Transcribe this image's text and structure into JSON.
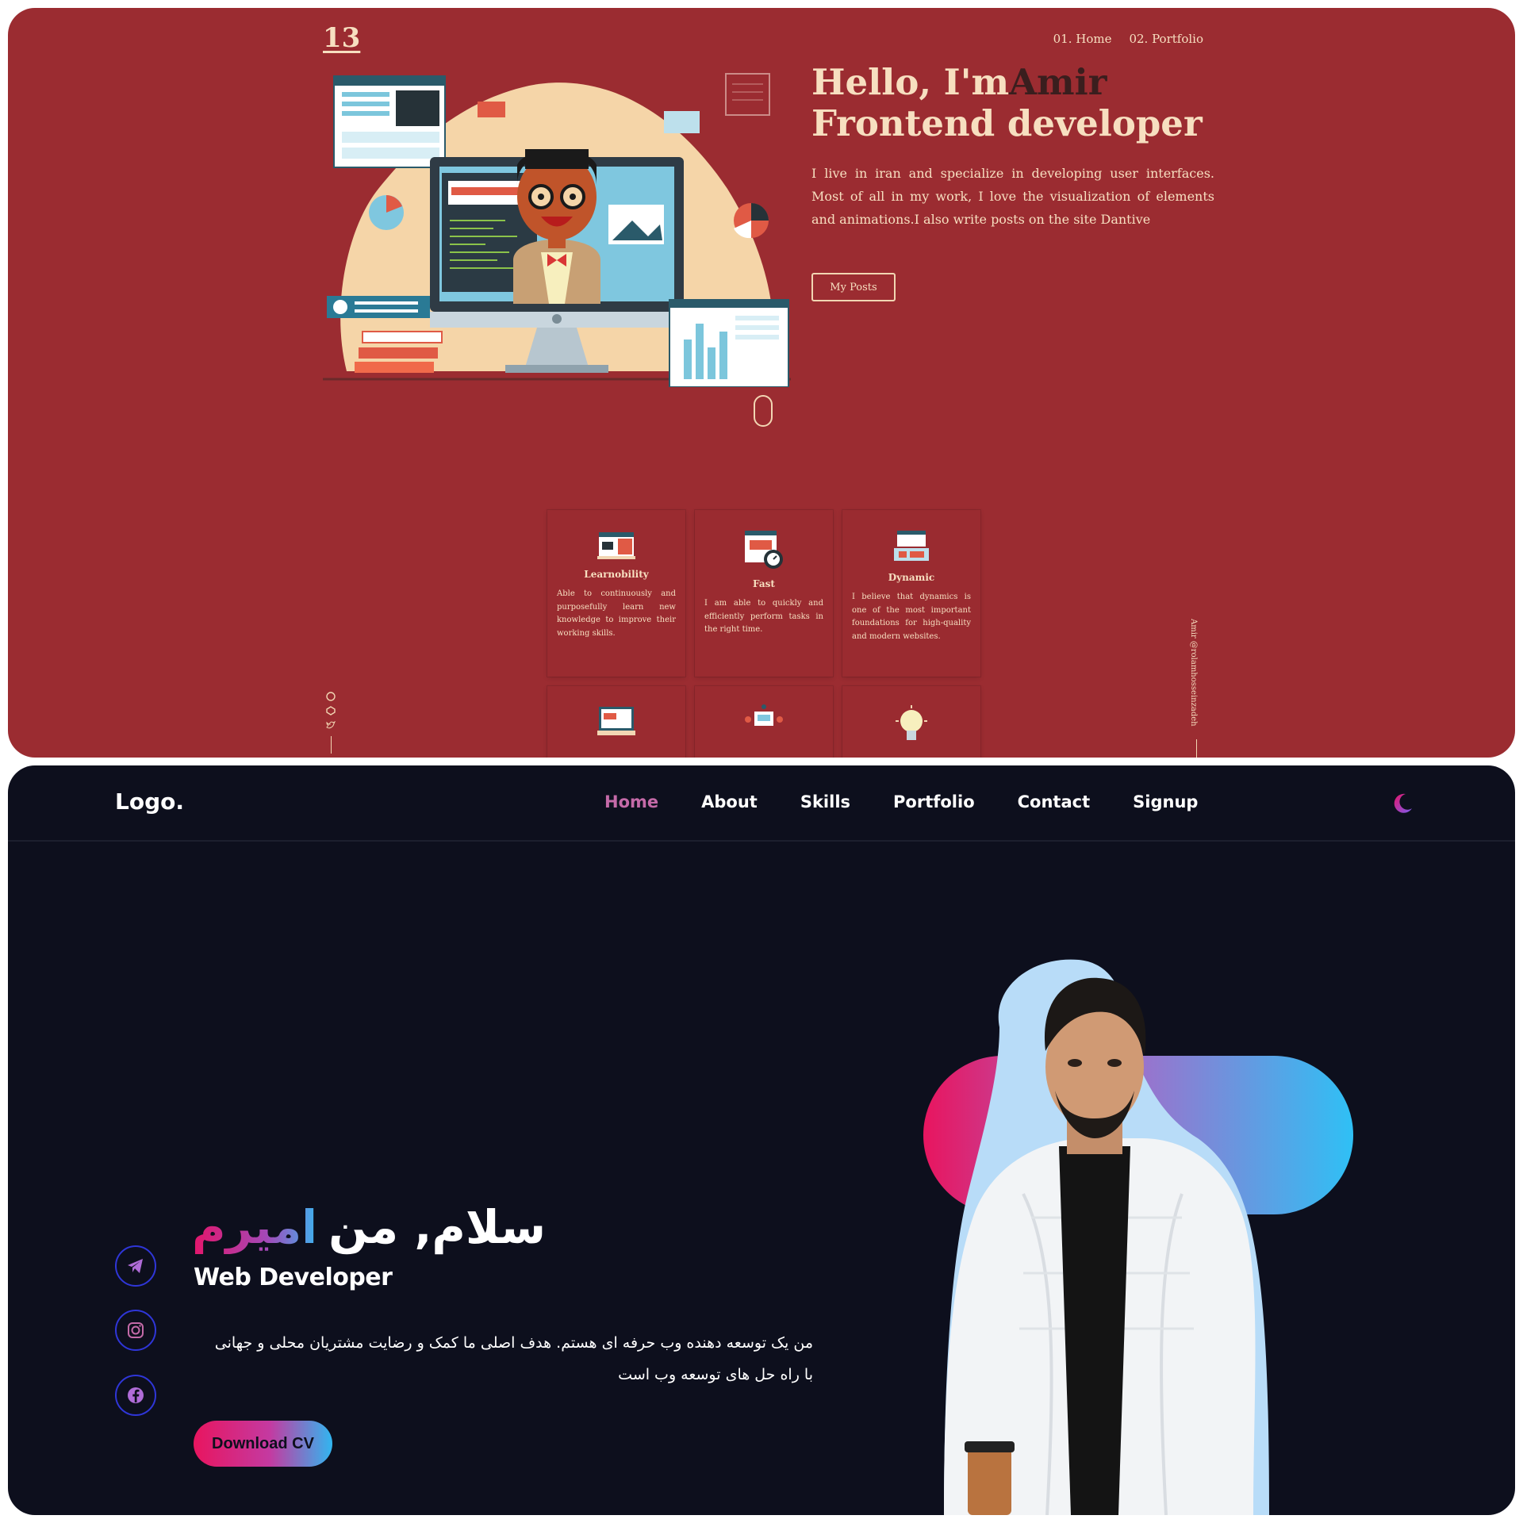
{
  "portfolio_red": {
    "logo": "13",
    "nav": [
      "01. Home",
      "02. Portfolio"
    ],
    "greeting": "Hello, I'm",
    "name": "Amir",
    "role": "Frontend developer",
    "bio": "I live in iran and specialize in developing user interfaces. Most of all in my work, I love the visualization of elements and animations.I also write posts on the site Dantive",
    "button": "My Posts",
    "vertical_text": "Amir @rolamhosseinzadeh",
    "social_icons": [
      "github-icon",
      "codepen-icon",
      "twitter-icon"
    ],
    "cards": [
      {
        "title": "Learnobility",
        "text": "Able to continuously and purposefully learn new knowledge to improve their working skills.",
        "icon": "learning-icon"
      },
      {
        "title": "Fast",
        "text": "I am able to quickly and efficiently perform tasks in the right time.",
        "icon": "stopwatch-icon"
      },
      {
        "title": "Dynamic",
        "text": "I believe that dynamics is one of the most important foundations for high-quality and modern websites.",
        "icon": "dynamic-icon"
      }
    ],
    "colors": {
      "background": "#9b2c31",
      "text": "#f7dfc0",
      "accent": "#3a1e1e"
    }
  },
  "portfolio_dark": {
    "logo": "Logo.",
    "nav": [
      "Home",
      "About",
      "Skills",
      "Portfolio",
      "Contact",
      "Signup"
    ],
    "active_nav": "Home",
    "headline_white": "سلام, من",
    "headline_gradient": "امیرم",
    "role": "Web Developer",
    "description": "من یک توسعه دهنده وب حرفه ای هستم. هدف اصلی ما کمک و رضایت مشتریان محلی و جهانی با راه حل های توسعه وب است",
    "button": "Download CV",
    "social_icons": [
      "telegram-icon",
      "instagram-icon",
      "facebook-icon"
    ],
    "theme_toggle": "moon-icon",
    "colors": {
      "background": "#0d0f1d",
      "gradient_start": "#e5156a",
      "gradient_end": "#31b6f0",
      "social_ring": "#2f36d8"
    }
  }
}
